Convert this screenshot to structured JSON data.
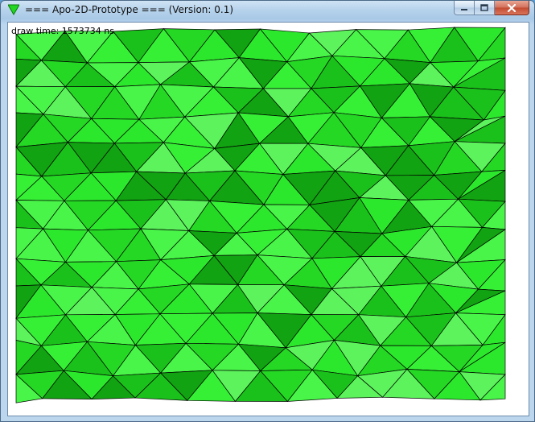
{
  "window": {
    "title": "=== Apo-2D-Prototype === (Version: 0.1)",
    "controls": [
      "minimize",
      "maximize",
      "close"
    ]
  },
  "app_icon": "green-down-triangle-icon",
  "canvas": {
    "draw_time": "draw time: 1573734 ns",
    "mesh_shades": [
      "#11a311",
      "#1bc11b",
      "#24d824",
      "#2ce82c",
      "#36f036",
      "#48f548",
      "#5cf35c"
    ],
    "stroke_color": "#000000"
  },
  "colors": {
    "client_background": "#ffffff",
    "close_button": "#c8503a"
  }
}
